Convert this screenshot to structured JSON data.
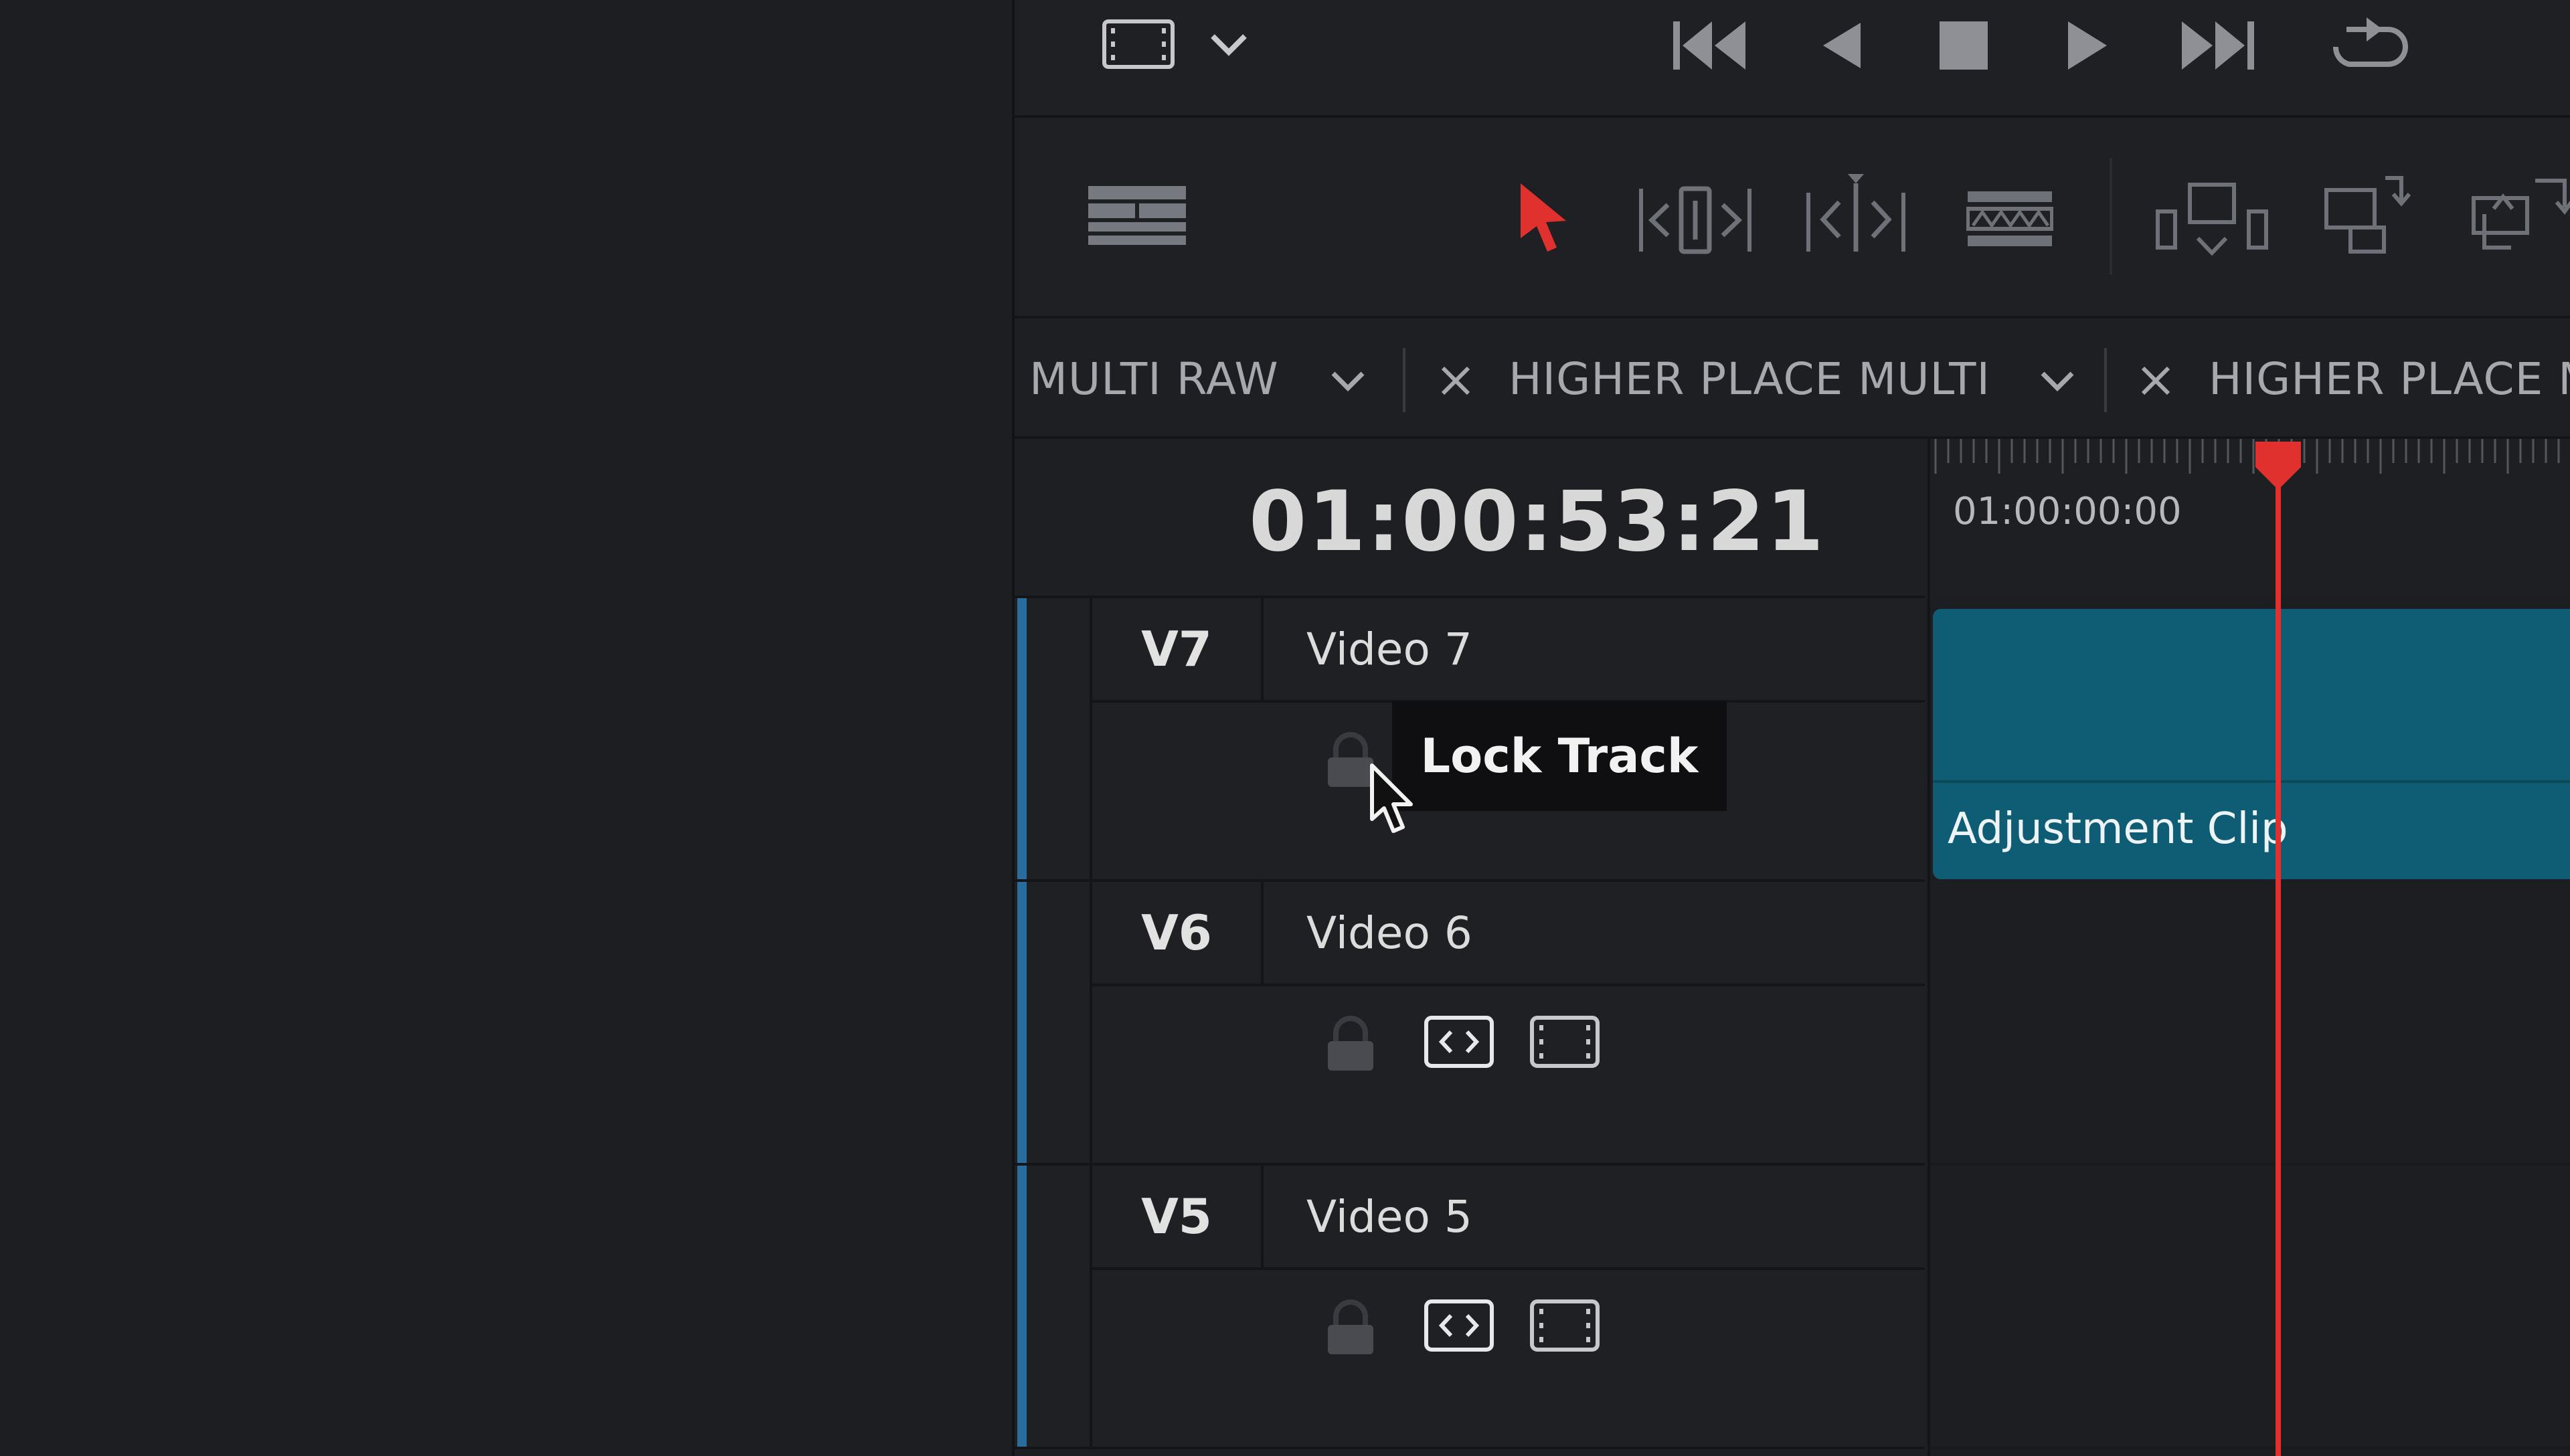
{
  "transport": {
    "icons": [
      "film-frame-icon",
      "chevron-down-icon",
      "skip-to-start-icon",
      "step-back-icon",
      "stop-icon",
      "play-icon",
      "skip-to-end-icon",
      "loop-icon"
    ]
  },
  "toolbar": {
    "icons": [
      "timeline-view-options-icon",
      "selection-mode-arrow-icon",
      "trim-edit-icon",
      "dynamic-trim-icon",
      "blade-edit-icon",
      "insert-clip-icon",
      "overwrite-clip-icon",
      "replace-clip-icon"
    ],
    "accent": "#e0312e"
  },
  "tabs": [
    {
      "label": "MULTI RAW"
    },
    {
      "label": "HIGHER PLACE MULTI"
    },
    {
      "label": "HIGHER PLACE M"
    }
  ],
  "timeline": {
    "timecode": "01:00:53:21",
    "ruler_start": "01:00:00:00"
  },
  "tracks": [
    {
      "id": "V7",
      "name": "Video 7"
    },
    {
      "id": "V6",
      "name": "Video 6"
    },
    {
      "id": "V5",
      "name": "Video 5"
    }
  ],
  "clips": {
    "v7_label": "Adjustment Clip",
    "color": "#0f5d74"
  },
  "tooltip": {
    "text": "Lock Track"
  }
}
